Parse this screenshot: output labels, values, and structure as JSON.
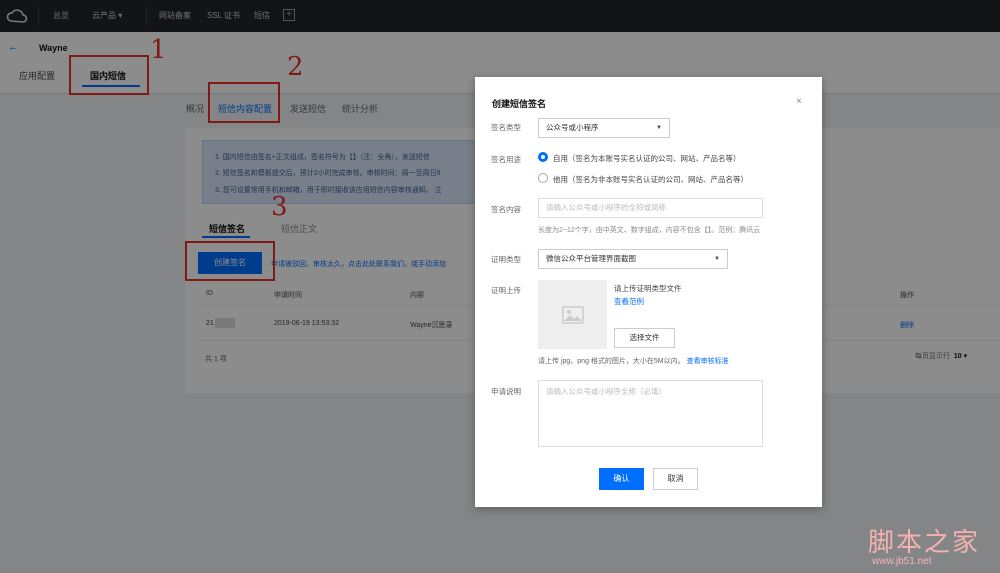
{
  "topnav": {
    "items": [
      "总览",
      "云产品 ▾",
      "网站备案",
      "SSL 证书",
      "短信"
    ],
    "plus": "+"
  },
  "header": {
    "back": "←",
    "title": "Wayne",
    "tabs": [
      "应用配置",
      "国内短信"
    ]
  },
  "inner_tabs": [
    "概况",
    "短信内容配置",
    "发送短信",
    "统计分析"
  ],
  "notice": [
    "1. 国内短信由签名+正文组成，签名符号为【】（注：全角），发送短信",
    "2. 短信签名和模板提交后，预计2小时完成审核。审核时间：周一至周日9",
    "3. 您可设置常用手机和邮箱，用于即时接收该应用短信内容审核通知。 立"
  ],
  "sig_tabs": [
    "短信签名",
    "短信正文"
  ],
  "create_button": "创建签名",
  "hint": "申请被驳回、审核太久，点击此处联系我们，或手动添加",
  "table": {
    "headers": [
      "ID",
      "申请时间",
      "内容",
      "操作"
    ],
    "row": {
      "id": "21",
      "time": "2019-06-19 13:53:32",
      "content": "Wayne沉思录",
      "action": "删除"
    }
  },
  "total": "共 1 项",
  "per_page_label": "每页显示行",
  "per_page_value": "10 ▾",
  "annotations": [
    "1",
    "2",
    "3"
  ],
  "modal": {
    "title": "创建短信签名",
    "close": "×",
    "type_label": "签名类型",
    "type_value": "公众号或小程序",
    "usage_label": "签名用途",
    "usage_options": [
      "自用（签名为本账号实名认证的公司、网站、产品名等）",
      "他用（签名为非本账号实名认证的公司、网站、产品名等）"
    ],
    "content_label": "签名内容",
    "content_placeholder": "请输入公众号或小程序的全称或简称",
    "content_help": "长度为2~12个字，由中英文、数字组成，内容不包含【】。范例：腾讯云",
    "proof_type_label": "证明类型",
    "proof_type_value": "微信公众平台管理界面截图",
    "upload_label": "证明上传",
    "upload_text": "请上传证明类型文件",
    "upload_example": "查看范例",
    "file_button": "选择文件",
    "upload_hint": "请上传 jpg、png 格式的图片，大小在5M以内。",
    "upload_hint_link": "查看审核标准",
    "desc_label": "申请说明",
    "desc_placeholder": "请输入公众号或小程序全称（必填）",
    "ok": "确认",
    "cancel": "取消"
  },
  "watermark": "脚本之家",
  "watermark_url": "www.jb51.net",
  "colors": {
    "primary": "#006eff",
    "annotation": "#e8312a",
    "nav_bg": "#222529"
  }
}
